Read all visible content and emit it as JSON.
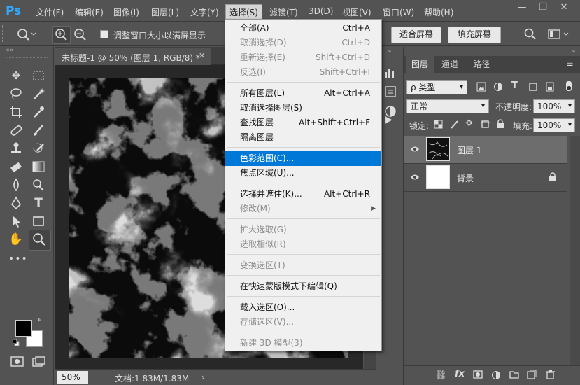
{
  "app_logo": "Ps",
  "menu": [
    "文件(F)",
    "编辑(E)",
    "图像(I)",
    "图层(L)",
    "文字(Y)",
    "选择(S)",
    "滤镜(T)",
    "3D(D)",
    "视图(V)",
    "窗口(W)",
    "帮助(H)"
  ],
  "window_controls": {
    "minimize": "—",
    "restore": "❐",
    "close": "✕"
  },
  "options": {
    "resize_windows_label": "调整窗口大小以满屏显示",
    "fit_screen": "适合屏幕",
    "fill_screen": "填充屏幕"
  },
  "document": {
    "tab_title": "未标题-1 @ 50% (图层 1, RGB/8) *",
    "zoom": "50%",
    "doc_size": "文档:1.83M/1.83M"
  },
  "select_menu": {
    "items": [
      {
        "label": "全部(A)",
        "shortcut": "Ctrl+A",
        "disabled": false
      },
      {
        "label": "取消选择(D)",
        "shortcut": "Ctrl+D",
        "disabled": true
      },
      {
        "label": "重新选择(E)",
        "shortcut": "Shift+Ctrl+D",
        "disabled": true
      },
      {
        "label": "反选(I)",
        "shortcut": "Shift+Ctrl+I",
        "disabled": true
      },
      {
        "label": "所有图层(L)",
        "shortcut": "Alt+Ctrl+A",
        "disabled": false
      },
      {
        "label": "取消选择图层(S)",
        "shortcut": "",
        "disabled": false
      },
      {
        "label": "查找图层",
        "shortcut": "Alt+Shift+Ctrl+F",
        "disabled": false
      },
      {
        "label": "隔离图层",
        "shortcut": "",
        "disabled": false
      },
      {
        "label": "色彩范围(C)...",
        "shortcut": "",
        "disabled": false
      },
      {
        "label": "焦点区域(U)...",
        "shortcut": "",
        "disabled": false
      },
      {
        "label": "选择并遮住(K)...",
        "shortcut": "Alt+Ctrl+R",
        "disabled": false
      },
      {
        "label": "修改(M)",
        "shortcut": "",
        "disabled": true
      },
      {
        "label": "扩大选取(G)",
        "shortcut": "",
        "disabled": true
      },
      {
        "label": "选取相似(R)",
        "shortcut": "",
        "disabled": true
      },
      {
        "label": "变换选区(T)",
        "shortcut": "",
        "disabled": true
      },
      {
        "label": "在快速蒙版模式下编辑(Q)",
        "shortcut": "",
        "disabled": false
      },
      {
        "label": "载入选区(O)...",
        "shortcut": "",
        "disabled": false
      },
      {
        "label": "存储选区(V)...",
        "shortcut": "",
        "disabled": true
      },
      {
        "label": "新建 3D 模型(3)",
        "shortcut": "",
        "disabled": true
      }
    ],
    "highlighted_index": 8
  },
  "layers_panel": {
    "tabs": [
      "图层",
      "通道",
      "路径"
    ],
    "filter_kind": "ρ 类型",
    "blend_mode": "正常",
    "opacity_label": "不透明度:",
    "opacity_value": "100%",
    "lock_label": "锁定:",
    "fill_label": "填充:",
    "fill_value": "100%",
    "layers": [
      {
        "name": "图层 1",
        "selected": true,
        "locked": false
      },
      {
        "name": "背景",
        "selected": false,
        "locked": true
      }
    ]
  },
  "colors": {
    "menu_highlight": "#0078d7",
    "foreground": "#000000",
    "background": "#ffffff",
    "ps_blue": "#31a8ff"
  }
}
